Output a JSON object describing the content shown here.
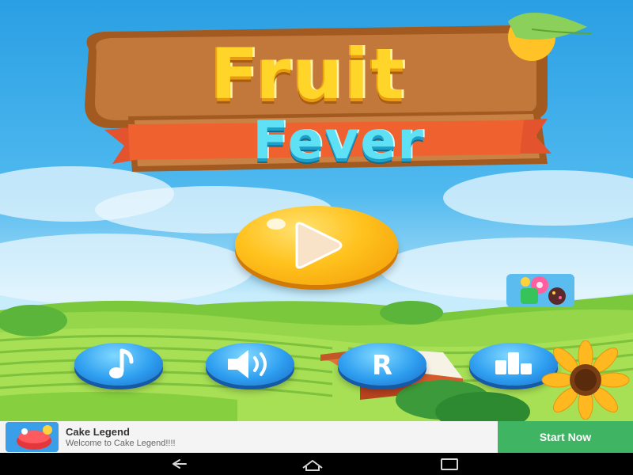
{
  "game": {
    "title_word1": "Fruit",
    "title_word2": "Fever"
  },
  "menu": {
    "play_icon": "play-icon",
    "buttons": [
      {
        "id": "music",
        "icon": "music-note-icon"
      },
      {
        "id": "sound",
        "icon": "speaker-icon"
      },
      {
        "id": "rate",
        "icon_text": "R"
      },
      {
        "id": "leaderboard",
        "icon": "leaderboard-icon"
      }
    ],
    "promo_icon": "game-promo-icon"
  },
  "ad": {
    "title": "Cake Legend",
    "subtitle": "Welcome to Cake Legend!!!!",
    "cta": "Start Now"
  },
  "colors": {
    "sky": "#2a9fe3",
    "play_button": "#ffc21d",
    "round_button": "#2f9ff0",
    "ad_cta": "#3fb463",
    "logo_fruit": "#ffd52a",
    "logo_fever": "#5ee0f5"
  },
  "navigation": [
    "back-icon",
    "home-icon",
    "recent-apps-icon"
  ]
}
